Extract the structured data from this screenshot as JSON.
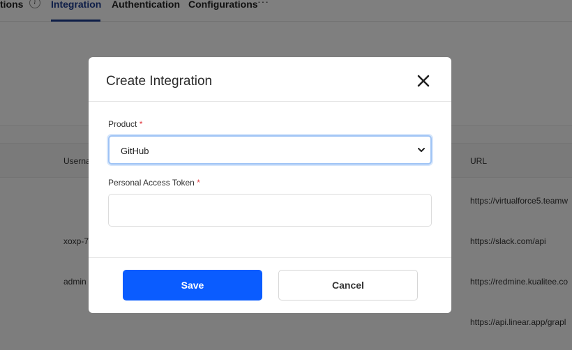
{
  "tabs": {
    "partial_tab": "tions",
    "integration": "Integration",
    "authentication": "Authentication",
    "configurations": "Configurations",
    "more": "···"
  },
  "table": {
    "username_header": "Userna",
    "url_header": "URL",
    "rows": [
      {
        "username": "",
        "url": "https://virtualforce5.teamw"
      },
      {
        "username": "xoxp-7",
        "url": "https://slack.com/api"
      },
      {
        "username": "admin",
        "url": "https://redmine.kualitee.co"
      },
      {
        "username": "",
        "url": "https://api.linear.app/grapl"
      }
    ]
  },
  "modal": {
    "title": "Create Integration",
    "product_label": "Product",
    "product_value": "GitHub",
    "token_label": "Personal Access Token",
    "token_value": "",
    "required_mark": "*",
    "save_label": "Save",
    "cancel_label": "Cancel"
  },
  "colors": {
    "primary": "#0a5cff",
    "required": "#e0383e",
    "active_tab": "#1a3a8f"
  }
}
